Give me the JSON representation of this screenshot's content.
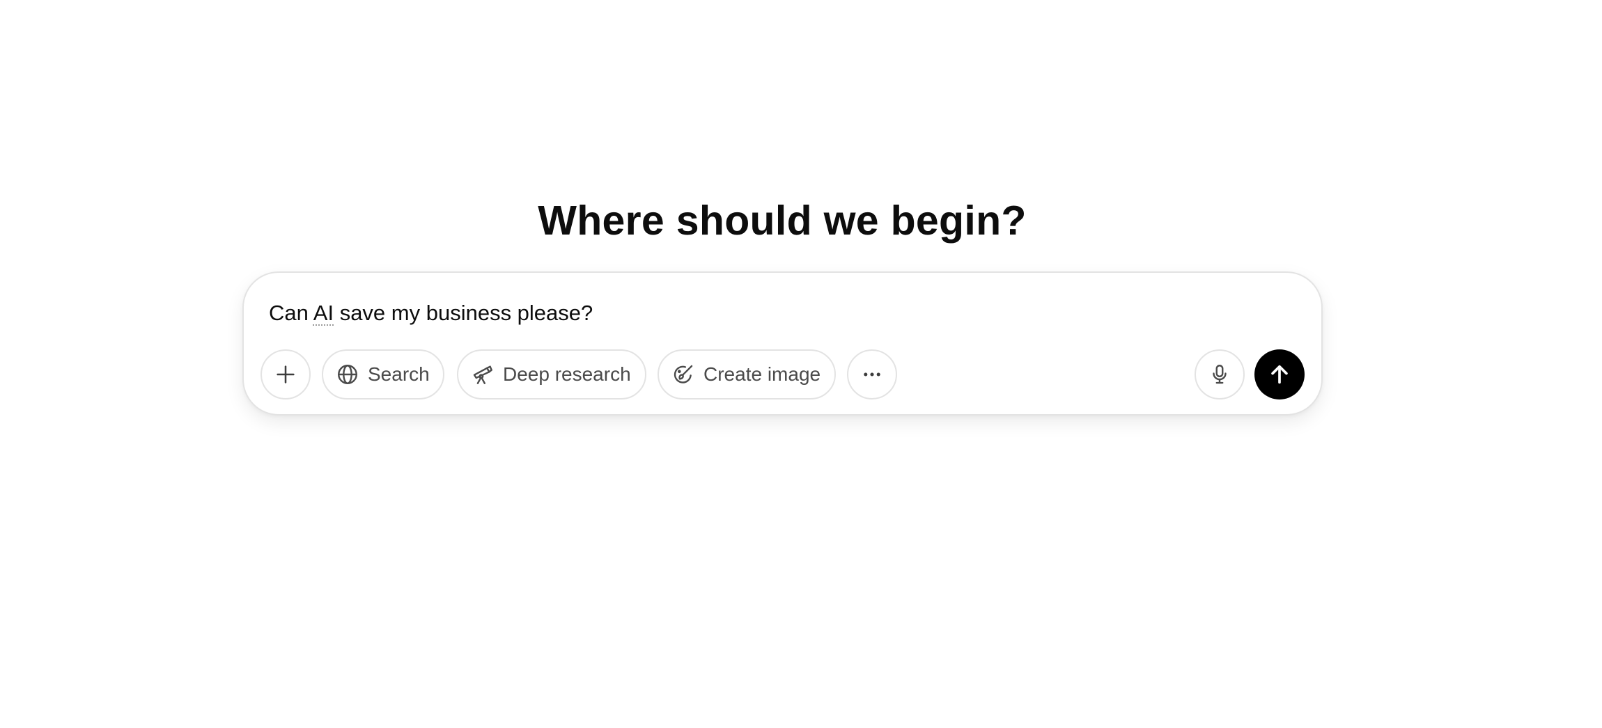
{
  "main": {
    "heading": "Where should we begin?"
  },
  "composer": {
    "prompt_before": "Can ",
    "prompt_flagged": "AI",
    "prompt_after": " save my business please?",
    "tools": {
      "add_icon": "plus-icon",
      "search_label": "Search",
      "search_icon": "globe-icon",
      "deep_research_label": "Deep research",
      "deep_research_icon": "telescope-icon",
      "create_image_label": "Create image",
      "create_image_icon": "paintbrush-icon",
      "more_icon": "ellipsis-icon",
      "voice_icon": "microphone-icon",
      "send_icon": "arrow-up-icon"
    }
  },
  "colors": {
    "send_button": "#000000",
    "pill_border": "#e3e3e3",
    "text": "#0d0d0d"
  }
}
